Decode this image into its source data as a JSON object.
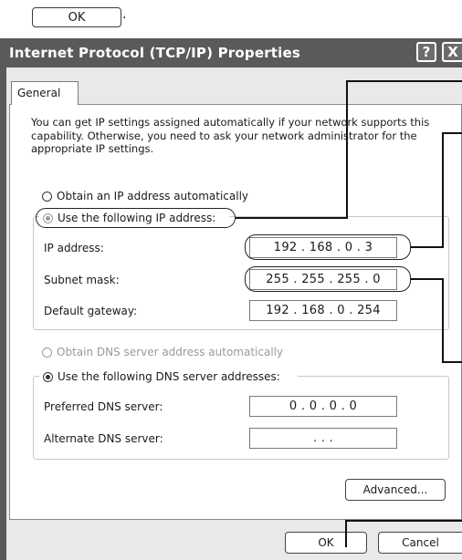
{
  "top_ok": {
    "label": "OK",
    "trailing": "."
  },
  "dialog": {
    "title": "Internet Protocol (TCP/IP) Properties",
    "help_glyph": "?",
    "close_glyph": "X",
    "tab_label": "General",
    "description": "You can get IP settings assigned automatically if your network supports this capability. Otherwise, you need to ask your network administrator for the appropriate IP settings."
  },
  "ip_section": {
    "auto_option": "Obtain an IP address automatically",
    "manual_option": "Use the following IP address:",
    "selected": "manual",
    "fields": [
      {
        "label": "IP address:",
        "value": "192 . 168 .  0  .  3"
      },
      {
        "label": "Subnet mask:",
        "value": "255 . 255 . 255 .  0"
      },
      {
        "label": "Default gateway:",
        "value": "192 . 168 .  0  . 254"
      }
    ]
  },
  "dns_section": {
    "auto_option": "Obtain DNS server address automatically",
    "manual_option": "Use the following DNS server addresses:",
    "selected": "manual",
    "fields": [
      {
        "label": "Preferred DNS server:",
        "value": "0  .  0  .  0  .  0"
      },
      {
        "label": "Alternate DNS server:",
        "value": " .     .     . "
      }
    ]
  },
  "buttons": {
    "advanced": "Advanced...",
    "ok": "OK",
    "cancel": "Cancel"
  },
  "icons": [
    "radio-icon",
    "help-icon",
    "close-icon"
  ]
}
